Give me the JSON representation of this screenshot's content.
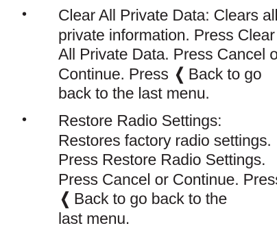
{
  "items": [
    {
      "bullet": "•",
      "lines": [
        "Clear All Private Data: Clears all",
        "private information. Press Clear",
        "All Private Data. Press Cancel or",
        "Continue. Press"
      ],
      "back_icon": "❮",
      "back_suffix_line4": "Back to go",
      "last_line": "back to the last menu."
    },
    {
      "bullet": "•",
      "lines": [
        "Restore Radio Settings:",
        "Restores factory radio settings.",
        "Press Restore Radio Settings.",
        "Press Cancel or Continue. Press"
      ],
      "back_icon": "❮",
      "back_suffix_line5": "Back to go back to the",
      "last_line": "last menu."
    }
  ]
}
